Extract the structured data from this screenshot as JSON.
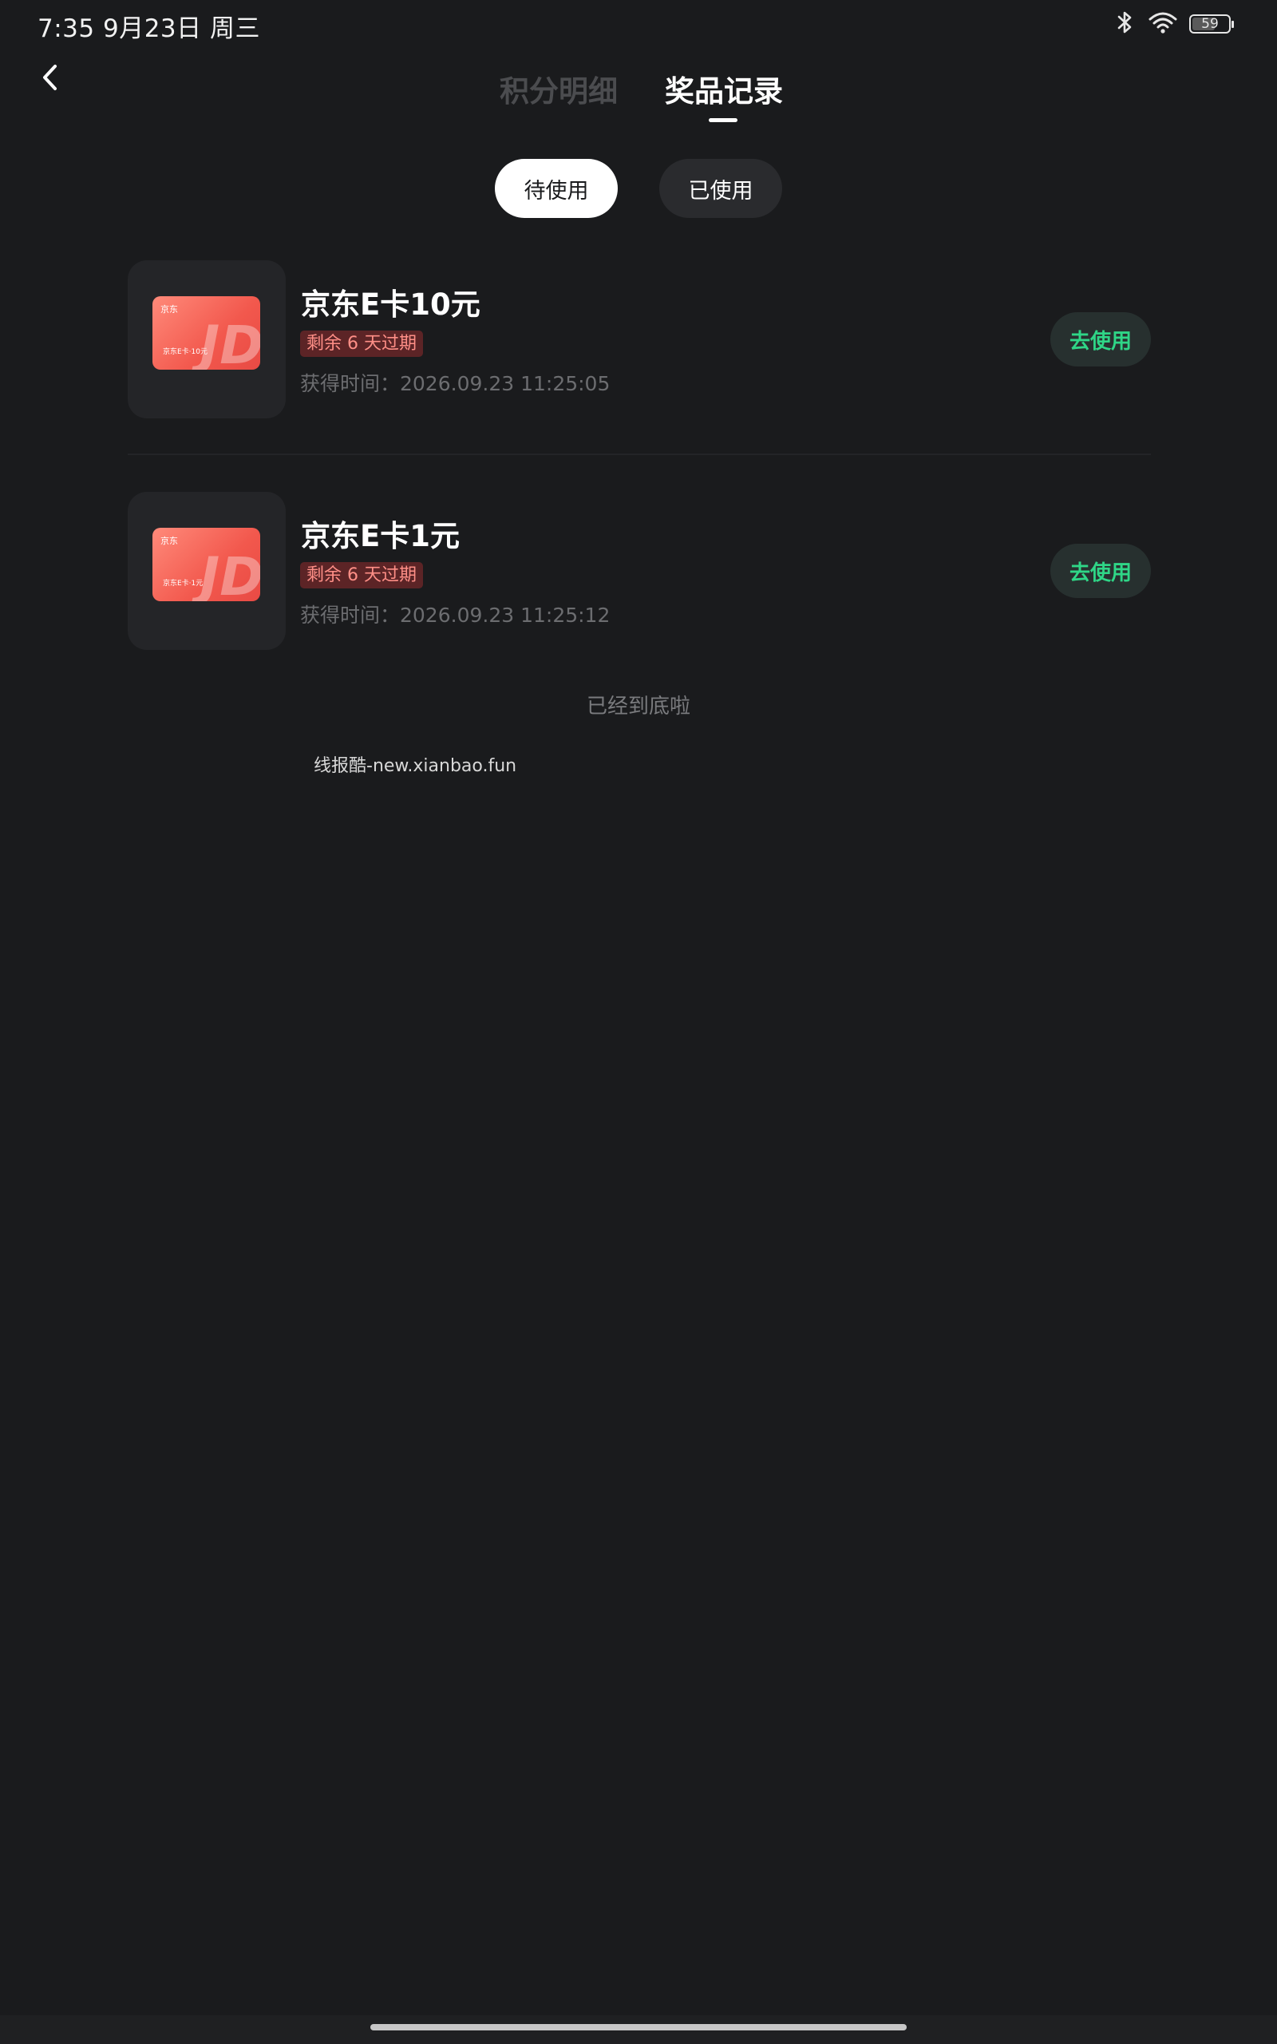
{
  "status_bar": {
    "time_date": "7:35  9月23日 周三",
    "battery": "59"
  },
  "header": {
    "tabs": [
      {
        "label": "积分明细",
        "active": false
      },
      {
        "label": "奖品记录",
        "active": true
      }
    ]
  },
  "filters": {
    "pending": "待使用",
    "used": "已使用",
    "selected": "待使用"
  },
  "prizes": [
    {
      "title": "京东E卡10元",
      "expire": "剩余 6 天过期",
      "obtained": "获得时间：2026.09.23 11:25:05",
      "action": "去使用",
      "card_logo": "京东",
      "card_caption": "京东E卡·10元"
    },
    {
      "title": "京东E卡1元",
      "expire": "剩余 6 天过期",
      "obtained": "获得时间：2026.09.23 11:25:12",
      "action": "去使用",
      "card_logo": "京东",
      "card_caption": "京东E卡·1元"
    }
  ],
  "end_text": "已经到底啦",
  "watermark": "线报酷-new.xianbao.fun",
  "colors": {
    "background": "#1a1b1d",
    "accent_green": "#2fd687",
    "badge_red": "#ff8f87",
    "card_red": "#f2584d"
  },
  "icons": [
    "back-arrow-icon",
    "bluetooth-icon",
    "wifi-icon",
    "battery-icon"
  ]
}
